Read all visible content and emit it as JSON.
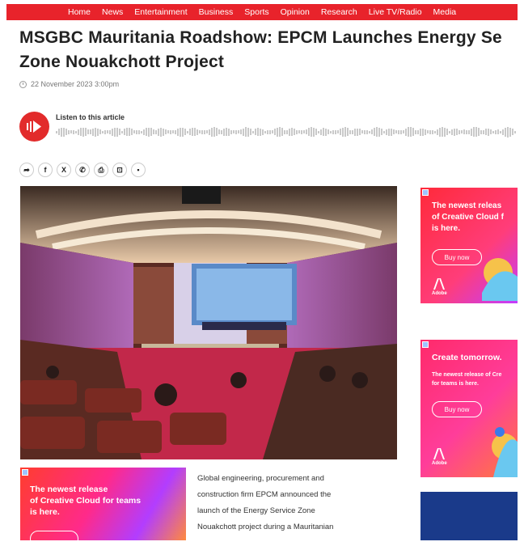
{
  "nav": {
    "items": [
      "Home",
      "News",
      "Entertainment",
      "Business",
      "Sports",
      "Opinion",
      "Research",
      "Live TV/Radio",
      "Media"
    ]
  },
  "article": {
    "title_line1": "MSGBC Mauritania Roadshow: EPCM Launches Energy Se",
    "title_line2": "Zone Nouakchott Project",
    "date": "22 November 2023 3:00pm",
    "listen_label": "Listen to this article",
    "body": [
      "Global engineering, procurement and",
      "construction firm EPCM announced the",
      "launch of the Energy Service Zone",
      "Nouakchott project during a Mauritanian"
    ]
  },
  "share_icons": [
    "share-icon",
    "facebook-icon",
    "x-icon",
    "whatsapp-icon",
    "print-icon",
    "bookmark-icon",
    "comment-icon"
  ],
  "ads": {
    "inline_text": [
      "The newest release",
      "of Creative Cloud for teams",
      "is here."
    ],
    "side1_text": [
      "The newest releas",
      "of Creative Cloud f",
      "is here."
    ],
    "side1_button": "Buy now",
    "side2_title": "Create tomorrow.",
    "side2_text": [
      "The newest release of Cre",
      "for teams is here."
    ],
    "side2_button": "Buy now",
    "brand": "Adobe"
  },
  "colors": {
    "nav_bg": "#e8232b",
    "accent": "#e22b2b"
  }
}
